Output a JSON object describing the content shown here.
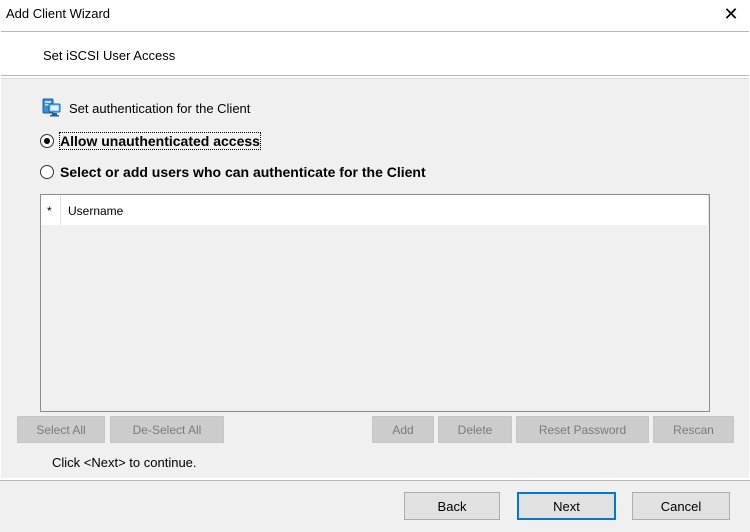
{
  "window": {
    "title": "Add Client Wizard",
    "close_glyph": "✕"
  },
  "header": {
    "title": "Set iSCSI User Access"
  },
  "section": {
    "label": "Set authentication for the Client",
    "icon": "client-computer-icon"
  },
  "options": {
    "allow_unauth": {
      "label": "Allow unauthenticated access",
      "selected": true
    },
    "select_users": {
      "label": "Select or add users who can authenticate for the Client",
      "selected": false
    }
  },
  "user_list": {
    "marker": "*",
    "column": "Username"
  },
  "list_buttons": {
    "select_all": "Select All",
    "deselect_all": "De-Select All",
    "add": "Add",
    "delete": "Delete",
    "reset_password": "Reset Password",
    "rescan": "Rescan"
  },
  "hint": "Click <Next> to continue.",
  "nav": {
    "back": "Back",
    "next": "Next",
    "cancel": "Cancel"
  },
  "colors": {
    "accent": "#0078d7",
    "disabled_bg": "#cccccc",
    "dialog_bg": "#f0f0f0"
  }
}
